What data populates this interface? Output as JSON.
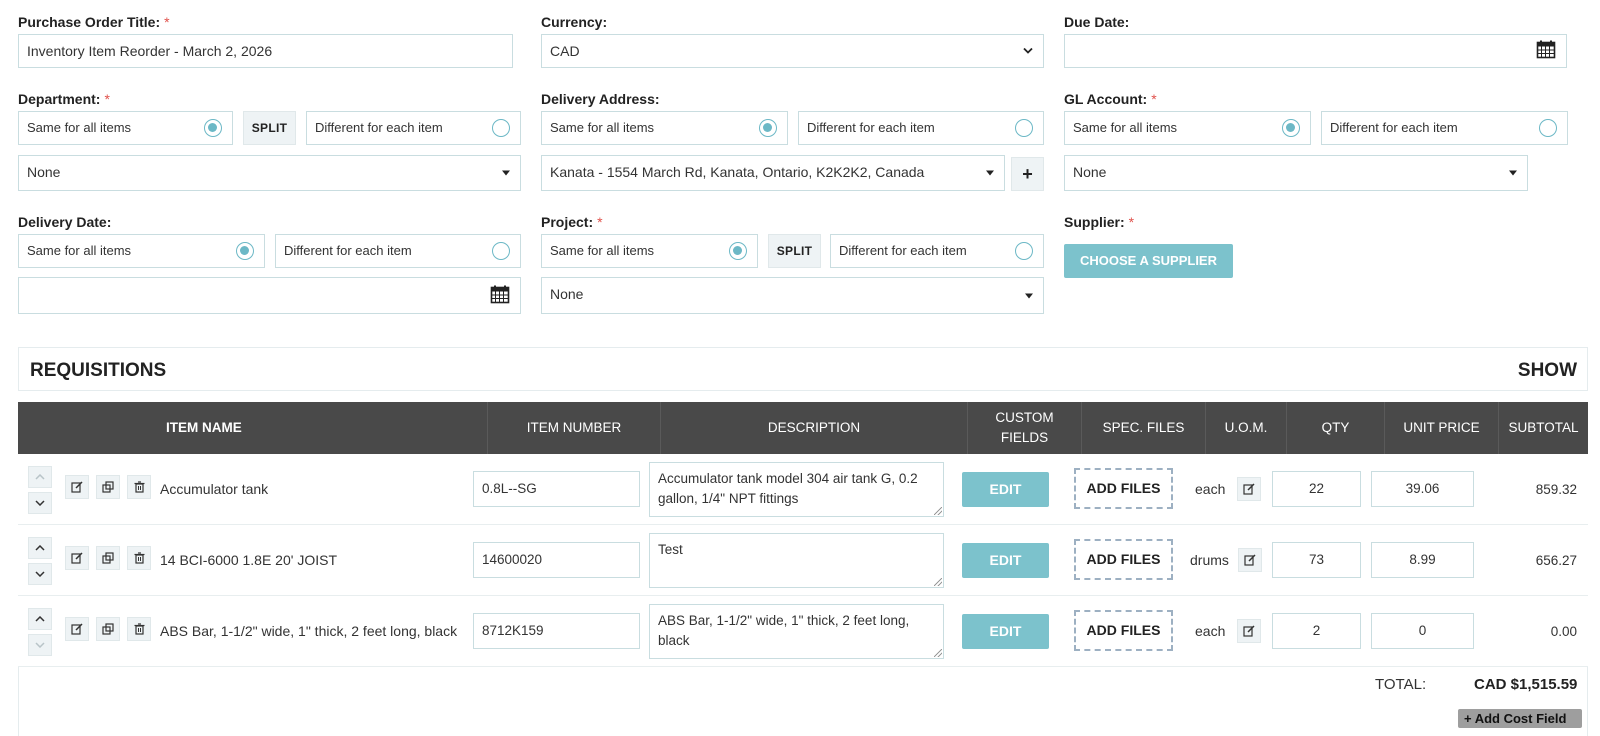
{
  "form": {
    "po_title": {
      "label": "Purchase Order Title:",
      "required": "*",
      "value": "Inventory Item Reorder - March 2, 2026"
    },
    "currency": {
      "label": "Currency:",
      "value": "CAD"
    },
    "due_date": {
      "label": "Due Date:",
      "value": ""
    },
    "department": {
      "label": "Department:",
      "required": "*",
      "same_label": "Same for all items",
      "split_label": "SPLIT",
      "different_label": "Different for each item",
      "selected": "same",
      "value": "None"
    },
    "delivery_address": {
      "label": "Delivery Address:",
      "same_label": "Same for all items",
      "different_label": "Different for each item",
      "selected": "same",
      "value": "Kanata - 1554 March Rd, Kanata, Ontario, K2K2K2, Canada",
      "add_label": "+"
    },
    "gl_account": {
      "label": "GL Account:",
      "required": "*",
      "same_label": "Same for all items",
      "different_label": "Different for each item",
      "selected": "same",
      "value": "None"
    },
    "delivery_date": {
      "label": "Delivery Date:",
      "same_label": "Same for all items",
      "different_label": "Different for each item",
      "selected": "same",
      "value": ""
    },
    "project": {
      "label": "Project:",
      "required": "*",
      "same_label": "Same for all items",
      "split_label": "SPLIT",
      "different_label": "Different for each item",
      "selected": "same",
      "value": "None"
    },
    "supplier": {
      "label": "Supplier:",
      "required": "*",
      "button_label": "CHOOSE A SUPPLIER"
    }
  },
  "requisitions": {
    "title": "REQUISITIONS",
    "toggle_label": "SHOW",
    "columns": [
      "ITEM NAME",
      "ITEM NUMBER",
      "DESCRIPTION",
      "CUSTOM\nFIELDS",
      "SPEC. FILES",
      "U.O.M.",
      "QTY",
      "UNIT PRICE",
      "SUBTOTAL"
    ],
    "rows": [
      {
        "item_name": "Accumulator tank",
        "item_number": "0.8L--SG",
        "description": "Accumulator tank model 304 air tank G, 0.2 gallon, 1/4\" NPT fittings",
        "edit_label": "EDIT",
        "files_label": "ADD FILES",
        "uom": "each",
        "qty": "22",
        "unit_price": "39.06",
        "subtotal": "859.32"
      },
      {
        "item_name": "14 BCI-6000 1.8E 20' JOIST",
        "item_number": "14600020",
        "description": "Test",
        "edit_label": "EDIT",
        "files_label": "ADD FILES",
        "uom": "drums",
        "qty": "73",
        "unit_price": "8.99",
        "subtotal": "656.27"
      },
      {
        "item_name": "ABS Bar, 1-1/2\" wide, 1\" thick, 2 feet long, black",
        "item_number": "8712K159",
        "description": "ABS Bar, 1-1/2\" wide, 1\" thick, 2 feet long, black",
        "edit_label": "EDIT",
        "files_label": "ADD FILES",
        "uom": "each",
        "qty": "2",
        "unit_price": "0",
        "subtotal": "0.00"
      }
    ],
    "total_label": "TOTAL:",
    "total_value": "CAD $1,515.59",
    "add_cost_label": "+ Add Cost Field"
  },
  "colors": {
    "accent": "#7cc2cc",
    "header_bg": "#494949",
    "border": "#c9dde0",
    "required": "#e0514b"
  }
}
